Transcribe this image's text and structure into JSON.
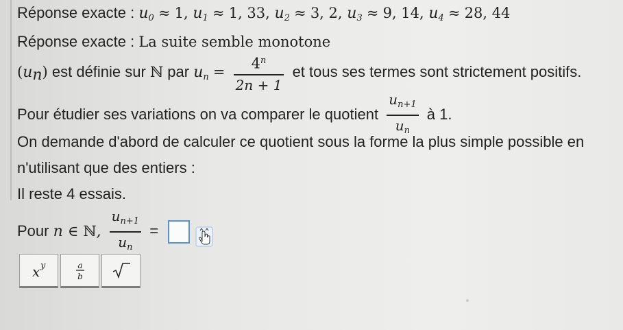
{
  "lines": {
    "exact_values_label": "Réponse exacte :",
    "exact_values": [
      {
        "name": "u",
        "sub": "0",
        "value": "1"
      },
      {
        "name": "u",
        "sub": "1",
        "value": "1, 33"
      },
      {
        "name": "u",
        "sub": "2",
        "value": "3, 2"
      },
      {
        "name": "u",
        "sub": "3",
        "value": "9, 14"
      },
      {
        "name": "u",
        "sub": "4",
        "value": "28, 44"
      }
    ],
    "exact_monotone_label": "Réponse exacte :",
    "exact_monotone_text": "La suite semble monotone",
    "definition_prefix": "est définie sur",
    "definition_set": "ℕ",
    "definition_par": "par",
    "definition_suffix": "et tous ses termes sont strictement positifs.",
    "formula_numerator": "4",
    "formula_numerator_exp": "n",
    "formula_denominator": "2n + 1",
    "quotient_sentence": "Pour étudier ses variations on va comparer le quotient",
    "quotient_suffix": "à 1.",
    "instruction_1": "On demande d'abord de calculer ce quotient sous la forme la plus simple possible en",
    "instruction_2": "n'utilisant que des entiers :",
    "attempts": "Il reste 4 essais.",
    "pour_label": "Pour",
    "equals": "="
  },
  "toolbar": {
    "buttons": [
      {
        "label": "x^y",
        "icon": "power-icon"
      },
      {
        "label": "a/b",
        "icon": "fraction-icon"
      },
      {
        "label": "√",
        "icon": "sqrt-icon"
      }
    ]
  },
  "colors": {
    "answer_box_border": "#5a8fd8",
    "text": "#222222"
  }
}
